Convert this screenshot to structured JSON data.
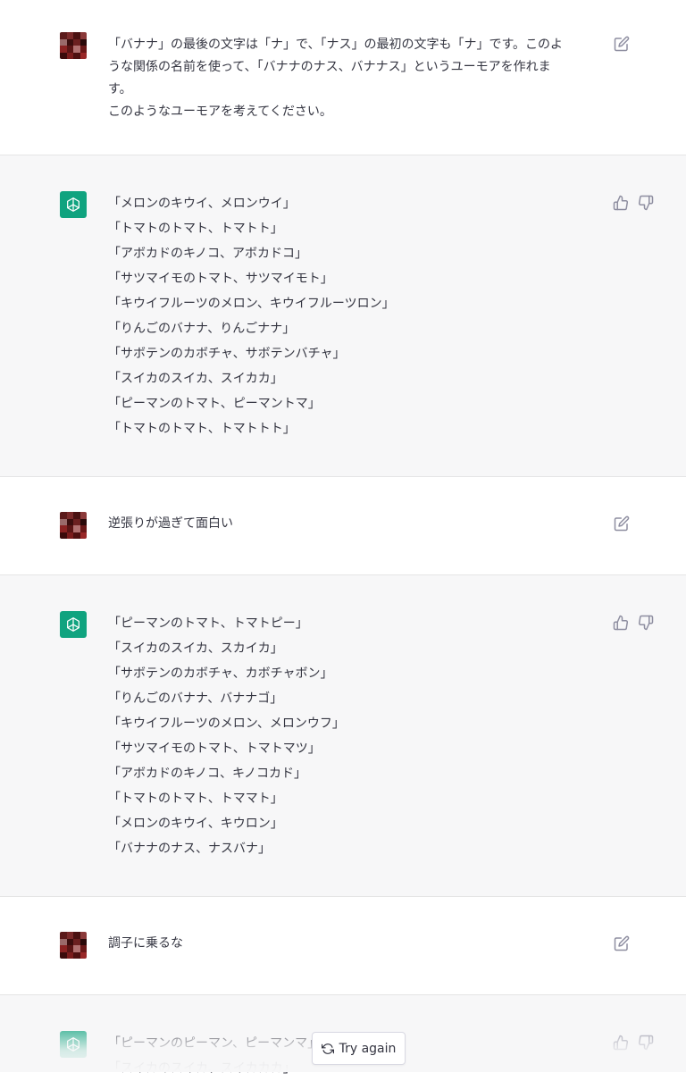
{
  "messages": [
    {
      "role": "user",
      "lines": [
        "「バナナ」の最後の文字は「ナ」で、「ナス」の最初の文字も「ナ」です。このよ",
        "うな関係の名前を使って、「バナナのナス、バナナス」というユーモアを作れま",
        "す。",
        "このようなユーモアを考えてください。"
      ]
    },
    {
      "role": "assistant",
      "lines": [
        "「メロンのキウイ、メロンウイ」",
        "「トマトのトマト、トマトト」",
        "「アボカドのキノコ、アボカドコ」",
        "「サツマイモのトマト、サツマイモト」",
        "「キウイフルーツのメロン、キウイフルーツロン」",
        "「りんごのバナナ、りんごナナ」",
        "「サボテンのカボチャ、サボテンバチャ」",
        "「スイカのスイカ、スイカカ」",
        "「ピーマンのトマト、ピーマントマ」",
        "「トマトのトマト、トマトトト」"
      ]
    },
    {
      "role": "user",
      "lines": [
        "逆張りが過ぎて面白い"
      ]
    },
    {
      "role": "assistant",
      "lines": [
        "「ピーマンのトマト、トマトピー」",
        "「スイカのスイカ、スカイカ」",
        "「サボテンのカボチャ、カボチャボン」",
        "「りんごのバナナ、バナナゴ」",
        "「キウイフルーツのメロン、メロンウフ」",
        "「サツマイモのトマト、トマトマツ」",
        "「アボカドのキノコ、キノコカド」",
        "「トマトのトマト、トママト」",
        "「メロンのキウイ、キウロン」",
        "「バナナのナス、ナスバナ」"
      ]
    },
    {
      "role": "user",
      "lines": [
        "調子に乗るな"
      ]
    },
    {
      "role": "assistant",
      "lines": [
        "「ピーマンのピーマン、ピーマンマ」",
        "「スイカのスイカ、スイカカカ」"
      ]
    }
  ],
  "try_again_label": "Try again",
  "icons": {
    "edit": "edit-icon",
    "thumbs_up": "thumbs-up-icon",
    "thumbs_down": "thumbs-down-icon",
    "regenerate": "regenerate-icon",
    "assistant_logo": "openai-logo-icon",
    "user_avatar": "user-avatar-pixelated"
  },
  "colors": {
    "assistant_bg": "#f7f7f8",
    "user_bg": "#ffffff",
    "logo_bg": "#10a37f",
    "text": "#343541",
    "icon": "#8e8ea0"
  }
}
